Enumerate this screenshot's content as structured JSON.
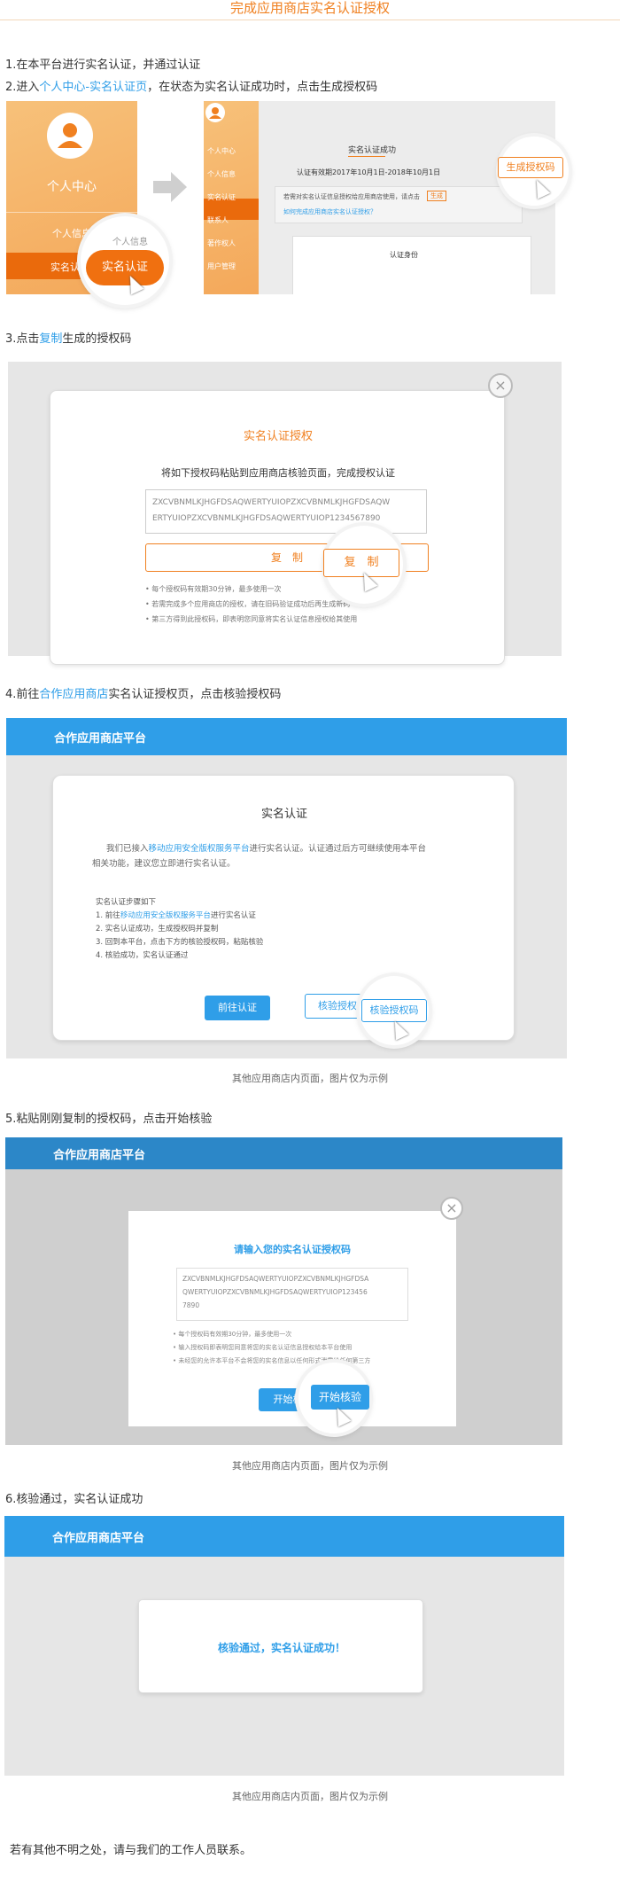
{
  "title": "完成应用商店实名认证授权",
  "steps": {
    "s1": "1.在本平台进行实名认证，并通过认证",
    "s2_prefix": "2.进入",
    "s2_link": "个人中心-实名认证页",
    "s2_suffix": "，在状态为实名认证成功时，点击生成授权码",
    "s3_prefix": "3.点击",
    "s3_link": "复制",
    "s3_suffix": "生成的授权码",
    "s4_prefix": "4.前往",
    "s4_link": "合作应用商店",
    "s4_suffix": "实名认证授权页，点击核验授权码",
    "s5": "5.粘贴刚刚复制的授权码，点击开始核验",
    "s6": "6.核验通过，实名认证成功"
  },
  "step2_image": {
    "left": {
      "personal_center": "个人中心",
      "personal_info": "个人信息",
      "personal_info2": "个人信息",
      "realname_partial": "实名认",
      "realname_btn": "实名认证"
    },
    "right": {
      "menu": [
        "个人中心",
        "个人信息",
        "实名认证",
        "联系人",
        "著作权人",
        "用户管理"
      ],
      "status_title": "实名认证成功",
      "validity": "认证有效期2017年10月1日-2018年10月1日",
      "desc": "若需对实名认证信息授权给应用商店使用，请点击",
      "desc_btn": "生成",
      "help": "如何完成应用商店实名认证授权？",
      "gen_btn": "生成授权码",
      "identity": "认证身份"
    }
  },
  "step3_image": {
    "dialog_title": "实名认证授权",
    "instruction": "将如下授权码粘贴到应用商店核验页面，完成授权认证",
    "code_line1": "ZXCVBNMLKJHGFDSAQWERTYUIOPZXCVBNMLKJHGFDSAQW",
    "code_line2": "ERTYUIOPZXCVBNMLKJHGFDSAQWERTYUIOP1234567890",
    "copy_btn": "复　制",
    "copy_zoom": "复　制",
    "notes": [
      "• 每个授权码有效期30分钟，最多使用一次",
      "• 若需完成多个应用商店的授权，请在旧码验证成功后再生成新码",
      "• 第三方得到此授权码，即表明您同意将实名认证信息授权给其使用"
    ],
    "close_icon": "×"
  },
  "step4_image": {
    "bar_title": "合作应用商店平台",
    "card_title": "实名认证",
    "intro_prefix": "我们已接入",
    "intro_link": "移动应用安全版权服务平台",
    "intro_suffix": "进行实名认证。认证通过后方可继续使用本平台",
    "intro_line2": "相关功能，建议您立即进行实名认证。",
    "steps_title": "实名认证步骤如下",
    "step1_prefix": "1. 前往",
    "step1_link": "移动应用安全版权服务平台",
    "step1_suffix": "进行实名认证",
    "step2": "2. 实名认证成功，生成授权码并复制",
    "step3": "3. 回到本平台，点击下方的核验授权码，粘贴核验",
    "step4": "4. 核验成功，实名认证通过",
    "goto_btn": "前往认证",
    "verify_btn_partial": "核验授权",
    "verify_btn": "核验授权码"
  },
  "step4_caption": "其他应用商店内页面，图片仅为示例",
  "step5_image": {
    "bar_title": "合作应用商店平台",
    "dialog_title": "请输入您的实名认证授权码",
    "code_line1": "ZXCVBNMLKJHGFDSAQWERTYUIOPZXCVBNMLKJHGFDSA",
    "code_line2": "QWERTYUIOPZXCVBNMLKJHGFDSAQWERTYUIOP123456",
    "code_line3": "7890",
    "notes": [
      "• 每个授权码有效期30分钟，最多使用一次",
      "• 输入授权码即表明您同意将您的实名认证信息授权给本平台使用",
      "• 未经您的允许本平台不会将您的实名信息以任何形式泄露给任何第三方"
    ],
    "start_partial": "开始核",
    "start_btn": "开始核验",
    "close_icon": "×"
  },
  "step5_caption": "其他应用商店内页面，图片仅为示例",
  "step6_image": {
    "bar_title": "合作应用商店平台",
    "success": "核验通过，实名认证成功！"
  },
  "step6_caption": "其他应用商店内页面，图片仅为示例",
  "footer": "若有其他不明之处，请与我们的工作人员联系。",
  "colors": {
    "orange": "#f08020",
    "blue": "#2f9ee8",
    "grey_bg": "#e6e6e6"
  }
}
